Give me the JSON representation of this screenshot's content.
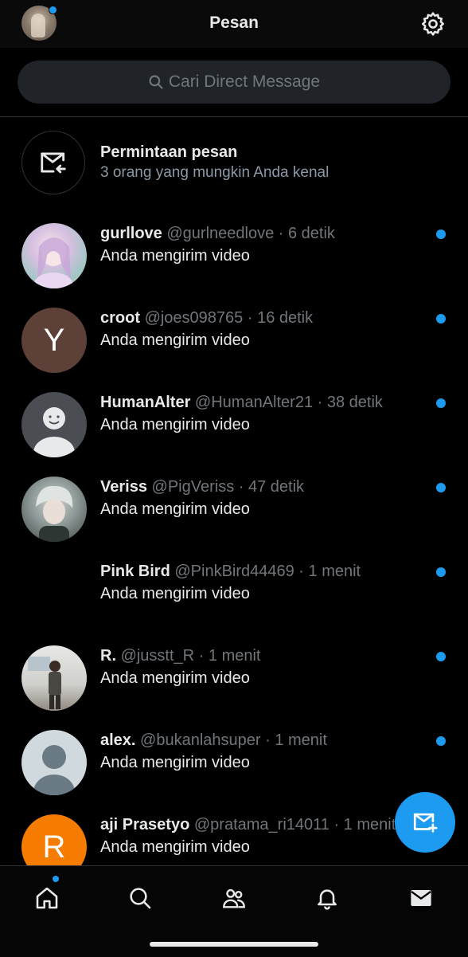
{
  "header": {
    "title": "Pesan",
    "settings_icon": "gear-icon"
  },
  "search": {
    "placeholder": "Cari Direct Message"
  },
  "requests": {
    "title": "Permintaan pesan",
    "subtitle": "3 orang yang mungkin Anda kenal"
  },
  "conversations": [
    {
      "name": "gurllove",
      "meta": "@gurlneedlove · 6 detik",
      "preview": "Anda mengirim video",
      "unread": true,
      "avatar": "anime-girl"
    },
    {
      "name": "croot",
      "meta": "@joes098765 · 16 detik",
      "preview": "Anda mengirim video",
      "unread": true,
      "avatar_letter": "Y",
      "avatar_color": "#5d4037"
    },
    {
      "name": "HumanAlter",
      "meta": "@HumanAlter21 · 38 detik",
      "preview": "Anda mengirim video",
      "unread": true,
      "avatar": "smiley"
    },
    {
      "name": "Veriss",
      "meta": "@PigVeriss · 47 detik",
      "preview": "Anda mengirim video",
      "unread": true,
      "avatar": "anime-boy"
    },
    {
      "name": "Pink Bird",
      "meta": "@PinkBird44469 · 1 menit",
      "preview": "Anda mengirim video",
      "unread": true,
      "avatar": "none"
    },
    {
      "name": "R.",
      "meta": "@jusstt_R · 1 menit",
      "preview": "Anda mengirim video",
      "unread": true,
      "avatar": "photo-person"
    },
    {
      "name": "alex.",
      "meta": "@bukanlahsuper · 1 menit",
      "preview": "Anda mengirim video",
      "unread": true,
      "avatar": "default"
    },
    {
      "name": "aji Prasetyo",
      "meta": "@pratama_ri14011 · 1 menit",
      "preview": "Anda mengirim video",
      "unread": false,
      "avatar_letter": "R",
      "avatar_color": "#f57c00"
    }
  ],
  "colors": {
    "accent": "#1d9bf0",
    "background": "#000000",
    "muted": "#71767b"
  },
  "nav": [
    "home-icon",
    "search-icon",
    "communities-icon",
    "bell-icon",
    "mail-icon"
  ]
}
